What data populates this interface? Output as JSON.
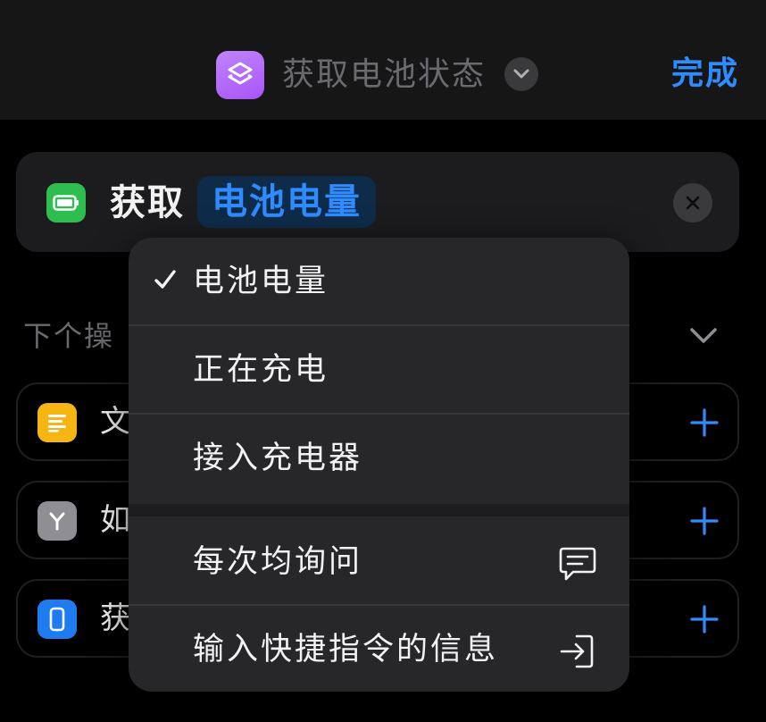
{
  "nav": {
    "title": "获取电池状态",
    "done_label": "完成",
    "app_icon": "shortcuts-layers-icon",
    "chevron_icon": "chevron-down-icon"
  },
  "action": {
    "verb": "获取",
    "parameter": "电池电量",
    "icon": "battery-icon",
    "clear_icon": "close-icon"
  },
  "next_section": {
    "label": "下个操",
    "chevron_icon": "chevron-down-icon"
  },
  "suggestions": [
    {
      "label": "文",
      "icon": "text-lines-icon",
      "icon_color": "#f5b614",
      "add_icon": "plus-icon"
    },
    {
      "label": "如",
      "icon": "branch-icon",
      "icon_color": "#8e8e93",
      "add_icon": "plus-icon"
    },
    {
      "label": "获",
      "icon": "phone-icon",
      "icon_color": "#1f7cf0",
      "add_icon": "plus-icon"
    }
  ],
  "menu": {
    "items": [
      {
        "label": "电池电量",
        "selected": true
      },
      {
        "label": "正在充电",
        "selected": false
      },
      {
        "label": "接入充电器",
        "selected": false
      },
      {
        "label": "每次均询问",
        "trailing_icon": "message-bubble-icon"
      },
      {
        "label": "输入快捷指令的信息",
        "trailing_icon": "input-arrow-icon"
      }
    ]
  },
  "colors": {
    "accent": "#2f8cff",
    "background": "#000000",
    "menu_background": "#272729",
    "card_background": "#1c1c1e"
  }
}
